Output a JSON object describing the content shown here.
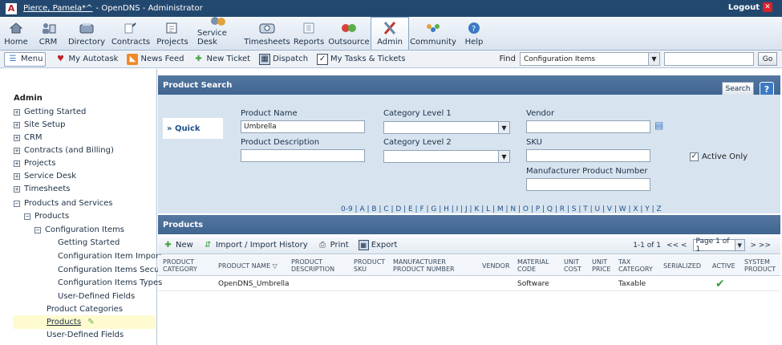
{
  "titlebar": {
    "user": "Pierce, Pamela*^",
    "app": "- OpenDNS - Administrator",
    "logout": "Logout"
  },
  "modules": [
    {
      "label": "Home",
      "icon": "home-icon"
    },
    {
      "label": "CRM",
      "icon": "crm-icon"
    },
    {
      "label": "Directory",
      "icon": "directory-icon"
    },
    {
      "label": "Contracts",
      "icon": "contracts-icon"
    },
    {
      "label": "Projects",
      "icon": "projects-icon"
    },
    {
      "label": "Service Desk",
      "icon": "service-desk-icon"
    },
    {
      "label": "Timesheets",
      "icon": "timesheets-icon"
    },
    {
      "label": "Reports",
      "icon": "reports-icon"
    },
    {
      "label": "Outsource",
      "icon": "outsource-icon"
    },
    {
      "label": "Admin",
      "icon": "admin-icon"
    },
    {
      "label": "Community",
      "icon": "community-icon"
    },
    {
      "label": "Help",
      "icon": "help-icon"
    }
  ],
  "toolbar": {
    "menu": "Menu",
    "my_autotask": "My Autotask",
    "news_feed": "News Feed",
    "new_ticket": "New Ticket",
    "dispatch": "Dispatch",
    "my_tasks": "My Tasks & Tickets",
    "find_label": "Find",
    "find_selected": "Configuration Items",
    "go": "Go"
  },
  "sidebar": {
    "heading": "Admin",
    "items": [
      "Getting Started",
      "Site Setup",
      "CRM",
      "Contracts (and Billing)",
      "Projects",
      "Service Desk",
      "Timesheets",
      "Products and Services",
      "Products",
      "Configuration Items",
      "Getting Started",
      "Configuration Item Import",
      "Configuration Items Security",
      "Configuration Items Types",
      "User-Defined Fields",
      "Product Categories",
      "Products",
      "User-Defined Fields"
    ]
  },
  "search": {
    "header": "Product Search",
    "search_button": "Search",
    "help": "?",
    "quick": "» Quick",
    "product_name_label": "Product Name",
    "product_name_value": "Umbrella",
    "product_description_label": "Product Description",
    "category1_label": "Category Level 1",
    "category2_label": "Category Level 2",
    "vendor_label": "Vendor",
    "sku_label": "SKU",
    "mpn_label": "Manufacturer Product Number",
    "active_only": "Active Only",
    "alphabet": "0-9 | A | B | C | D | E | F | G | H | I | J | K | L | M | N | O | P | Q | R | S | T | U | V | W | X | Y | Z"
  },
  "products": {
    "header": "Products",
    "new": "New",
    "import": "Import / Import History",
    "print": "Print",
    "export": "Export",
    "range": "1-1 of 1",
    "prev": "<< <",
    "page": "Page 1 of 1",
    "next": "> >>",
    "columns": {
      "c1a": "PRODUCT",
      "c1b": "CATEGORY",
      "c2": "PRODUCT NAME",
      "c3a": "PRODUCT",
      "c3b": "DESCRIPTION",
      "c4a": "PRODUCT",
      "c4b": "SKU",
      "c5a": "MANUFACTURER",
      "c5b": "PRODUCT NUMBER",
      "c6": "VENDOR",
      "c7a": "MATERIAL",
      "c7b": "CODE",
      "c8a": "UNIT",
      "c8b": "COST",
      "c9a": "UNIT",
      "c9b": "PRICE",
      "c10a": "TAX",
      "c10b": "CATEGORY",
      "c11": "SERIALIZED",
      "c12": "ACTIVE",
      "c13a": "SYSTEM",
      "c13b": "PRODUCT"
    },
    "rows": [
      {
        "name": "OpenDNS_Umbrella",
        "material_code": "Software",
        "tax_category": "Taxable"
      }
    ]
  }
}
